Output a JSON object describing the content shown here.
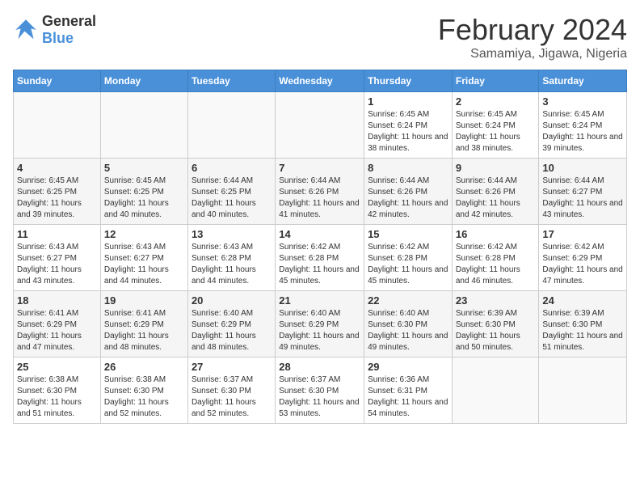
{
  "header": {
    "logo": {
      "text_general": "General",
      "text_blue": "Blue"
    },
    "title": "February 2024",
    "subtitle": "Samamiya, Jigawa, Nigeria"
  },
  "calendar": {
    "days_of_week": [
      "Sunday",
      "Monday",
      "Tuesday",
      "Wednesday",
      "Thursday",
      "Friday",
      "Saturday"
    ],
    "weeks": [
      [
        {
          "day": "",
          "info": ""
        },
        {
          "day": "",
          "info": ""
        },
        {
          "day": "",
          "info": ""
        },
        {
          "day": "",
          "info": ""
        },
        {
          "day": "1",
          "info": "Sunrise: 6:45 AM\nSunset: 6:24 PM\nDaylight: 11 hours and 38 minutes."
        },
        {
          "day": "2",
          "info": "Sunrise: 6:45 AM\nSunset: 6:24 PM\nDaylight: 11 hours and 38 minutes."
        },
        {
          "day": "3",
          "info": "Sunrise: 6:45 AM\nSunset: 6:24 PM\nDaylight: 11 hours and 39 minutes."
        }
      ],
      [
        {
          "day": "4",
          "info": "Sunrise: 6:45 AM\nSunset: 6:25 PM\nDaylight: 11 hours and 39 minutes."
        },
        {
          "day": "5",
          "info": "Sunrise: 6:45 AM\nSunset: 6:25 PM\nDaylight: 11 hours and 40 minutes."
        },
        {
          "day": "6",
          "info": "Sunrise: 6:44 AM\nSunset: 6:25 PM\nDaylight: 11 hours and 40 minutes."
        },
        {
          "day": "7",
          "info": "Sunrise: 6:44 AM\nSunset: 6:26 PM\nDaylight: 11 hours and 41 minutes."
        },
        {
          "day": "8",
          "info": "Sunrise: 6:44 AM\nSunset: 6:26 PM\nDaylight: 11 hours and 42 minutes."
        },
        {
          "day": "9",
          "info": "Sunrise: 6:44 AM\nSunset: 6:26 PM\nDaylight: 11 hours and 42 minutes."
        },
        {
          "day": "10",
          "info": "Sunrise: 6:44 AM\nSunset: 6:27 PM\nDaylight: 11 hours and 43 minutes."
        }
      ],
      [
        {
          "day": "11",
          "info": "Sunrise: 6:43 AM\nSunset: 6:27 PM\nDaylight: 11 hours and 43 minutes."
        },
        {
          "day": "12",
          "info": "Sunrise: 6:43 AM\nSunset: 6:27 PM\nDaylight: 11 hours and 44 minutes."
        },
        {
          "day": "13",
          "info": "Sunrise: 6:43 AM\nSunset: 6:28 PM\nDaylight: 11 hours and 44 minutes."
        },
        {
          "day": "14",
          "info": "Sunrise: 6:42 AM\nSunset: 6:28 PM\nDaylight: 11 hours and 45 minutes."
        },
        {
          "day": "15",
          "info": "Sunrise: 6:42 AM\nSunset: 6:28 PM\nDaylight: 11 hours and 45 minutes."
        },
        {
          "day": "16",
          "info": "Sunrise: 6:42 AM\nSunset: 6:28 PM\nDaylight: 11 hours and 46 minutes."
        },
        {
          "day": "17",
          "info": "Sunrise: 6:42 AM\nSunset: 6:29 PM\nDaylight: 11 hours and 47 minutes."
        }
      ],
      [
        {
          "day": "18",
          "info": "Sunrise: 6:41 AM\nSunset: 6:29 PM\nDaylight: 11 hours and 47 minutes."
        },
        {
          "day": "19",
          "info": "Sunrise: 6:41 AM\nSunset: 6:29 PM\nDaylight: 11 hours and 48 minutes."
        },
        {
          "day": "20",
          "info": "Sunrise: 6:40 AM\nSunset: 6:29 PM\nDaylight: 11 hours and 48 minutes."
        },
        {
          "day": "21",
          "info": "Sunrise: 6:40 AM\nSunset: 6:29 PM\nDaylight: 11 hours and 49 minutes."
        },
        {
          "day": "22",
          "info": "Sunrise: 6:40 AM\nSunset: 6:30 PM\nDaylight: 11 hours and 49 minutes."
        },
        {
          "day": "23",
          "info": "Sunrise: 6:39 AM\nSunset: 6:30 PM\nDaylight: 11 hours and 50 minutes."
        },
        {
          "day": "24",
          "info": "Sunrise: 6:39 AM\nSunset: 6:30 PM\nDaylight: 11 hours and 51 minutes."
        }
      ],
      [
        {
          "day": "25",
          "info": "Sunrise: 6:38 AM\nSunset: 6:30 PM\nDaylight: 11 hours and 51 minutes."
        },
        {
          "day": "26",
          "info": "Sunrise: 6:38 AM\nSunset: 6:30 PM\nDaylight: 11 hours and 52 minutes."
        },
        {
          "day": "27",
          "info": "Sunrise: 6:37 AM\nSunset: 6:30 PM\nDaylight: 11 hours and 52 minutes."
        },
        {
          "day": "28",
          "info": "Sunrise: 6:37 AM\nSunset: 6:30 PM\nDaylight: 11 hours and 53 minutes."
        },
        {
          "day": "29",
          "info": "Sunrise: 6:36 AM\nSunset: 6:31 PM\nDaylight: 11 hours and 54 minutes."
        },
        {
          "day": "",
          "info": ""
        },
        {
          "day": "",
          "info": ""
        }
      ]
    ]
  }
}
